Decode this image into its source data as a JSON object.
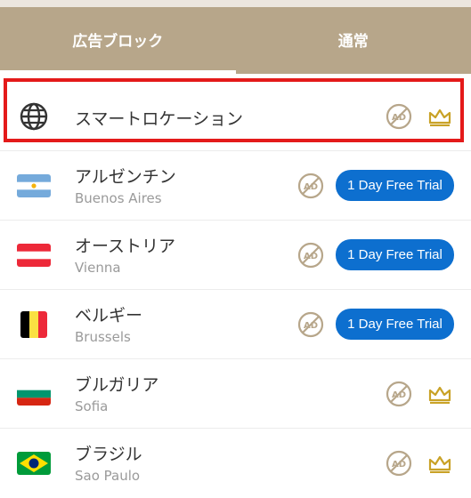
{
  "tabs": [
    {
      "label": "広告ブロック",
      "active": true
    },
    {
      "label": "通常",
      "active": false
    }
  ],
  "smart_location": {
    "label": "スマートロケーション",
    "icon": "globe-icon"
  },
  "locations": [
    {
      "name": "アルゼンチン",
      "city": "Buenos Aires",
      "flag": "argentina-flag",
      "trial_label": "1 Day Free Trial"
    },
    {
      "name": "オーストリア",
      "city": "Vienna",
      "flag": "austria-flag",
      "trial_label": "1 Day Free Trial"
    },
    {
      "name": "ベルギー",
      "city": "Brussels",
      "flag": "belgium-flag",
      "trial_label": "1 Day Free Trial"
    },
    {
      "name": "ブルガリア",
      "city": "Sofia",
      "flag": "bulgaria-flag",
      "premium": true
    },
    {
      "name": "ブラジル",
      "city": "Sao Paulo",
      "flag": "brazil-flag",
      "premium": true
    }
  ],
  "colors": {
    "tab_bar": "#b7a68a",
    "trial_button": "#0d6fcf",
    "highlight": "#e41a1a",
    "crown": "#c9a227",
    "ad_icon": "#b7a68a"
  }
}
